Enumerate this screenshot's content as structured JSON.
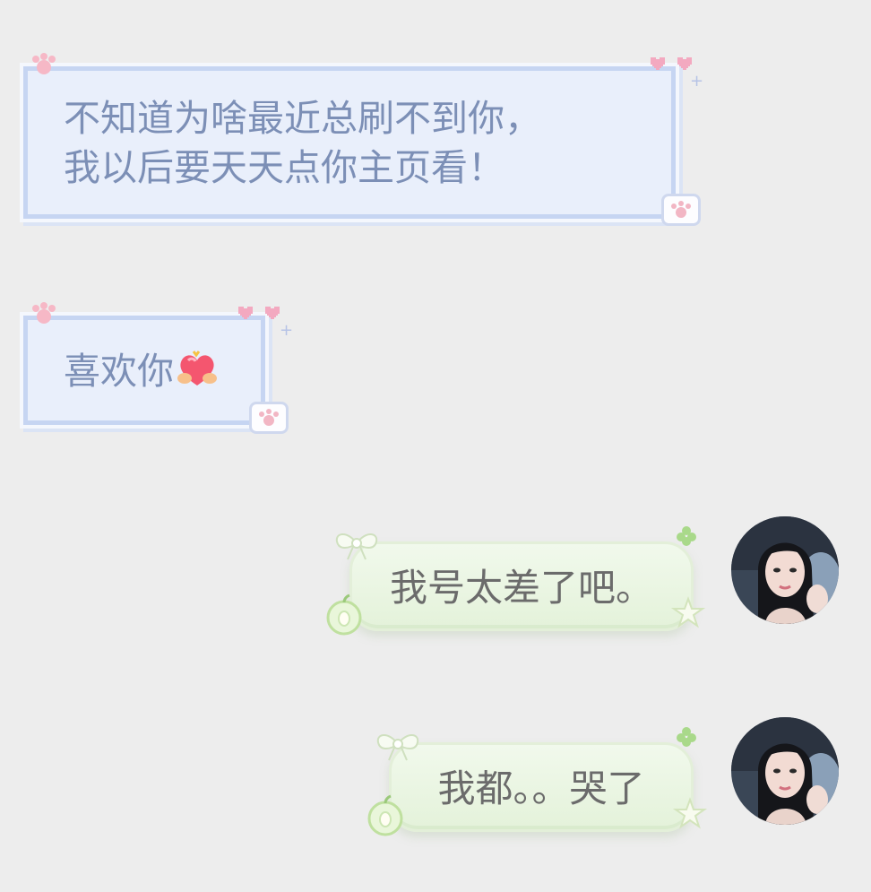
{
  "chat": {
    "messages": [
      {
        "side": "incoming",
        "lines": [
          "不知道为啥最近总刷不到你，",
          "我以后要天天点你主页看！"
        ]
      },
      {
        "side": "incoming",
        "text": "喜欢你",
        "emoji": "heart-hands-emoji"
      },
      {
        "side": "outgoing",
        "text": "我号太差了吧。"
      },
      {
        "side": "outgoing",
        "text": "我都。。哭了"
      }
    ]
  },
  "colors": {
    "background": "#ededed",
    "incoming_bubble": "#e9effb",
    "incoming_border": "#c6d5f2",
    "incoming_text": "#7c8fb6",
    "outgoing_bubble": "#e8f4df",
    "outgoing_text": "#6b6b6b",
    "accent_pink": "#f3a9c0",
    "accent_green": "#a9d98a"
  },
  "icons": [
    "paw-icon",
    "heart-icon",
    "sparkle-icon",
    "apple-icon",
    "clover-icon",
    "star-icon",
    "bow-icon",
    "avatar"
  ]
}
